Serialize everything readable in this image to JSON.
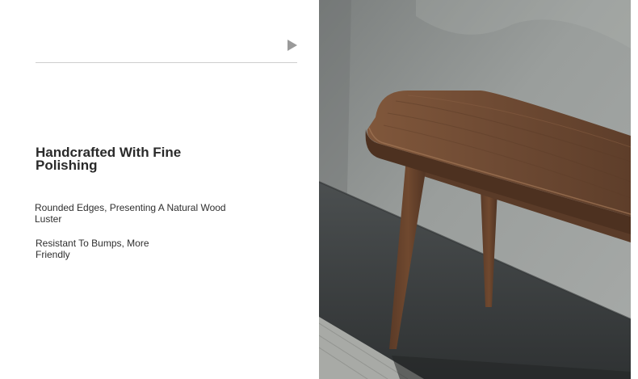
{
  "intro": {
    "heading": "Handcrafted With Fine Polishing",
    "features": [
      "Rounded Edges, Presenting A Natural Wood Luster",
      "Resistant To Bumps, More Friendly"
    ]
  },
  "icons": {
    "play": "play-icon"
  },
  "colors": {
    "wall": "#8f9392",
    "floor": "#3c3f40",
    "wood": "#6e4a34",
    "rug": "#a8aaa6"
  }
}
